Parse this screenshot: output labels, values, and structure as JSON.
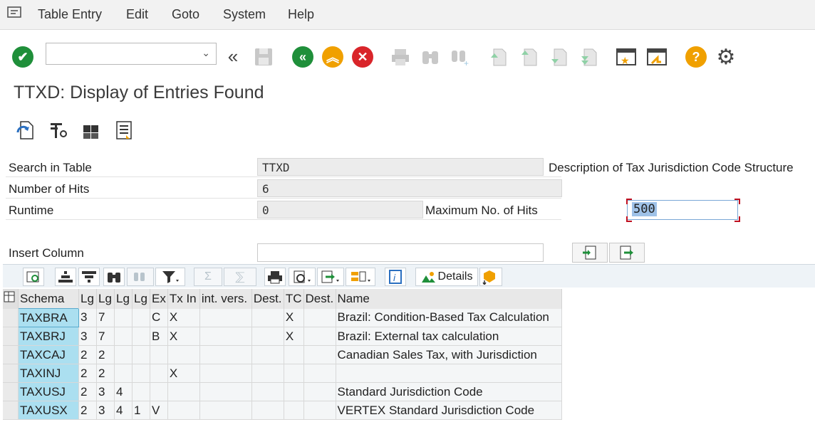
{
  "menu": {
    "items": [
      "Table Entry",
      "Edit",
      "Goto",
      "System",
      "Help"
    ]
  },
  "toolbar": {
    "command_value": ""
  },
  "page": {
    "title": "TTXD: Display of Entries Found"
  },
  "form": {
    "search_label": "Search in Table",
    "search_value": "TTXD",
    "search_desc": "Description of Tax Jurisdiction Code Structure",
    "hits_label": "Number of Hits",
    "hits_value": "6",
    "runtime_label": "Runtime",
    "runtime_value": "0",
    "maxhits_label": "Maximum No. of Hits",
    "maxhits_value": "500",
    "insert_label": "Insert Column",
    "insert_value": ""
  },
  "alv": {
    "details_label": "Details",
    "sum_label": "Σ"
  },
  "table": {
    "headers": [
      "Schema",
      "Lg",
      "Lg",
      "Lg",
      "Lg",
      "Ex",
      "Tx In",
      "int. vers.",
      "Dest.",
      "TC",
      "Dest.",
      "Name"
    ],
    "rows": [
      [
        "TAXBRA",
        "3",
        "7",
        "",
        "",
        "C",
        "X",
        "",
        "",
        "X",
        "",
        "Brazil: Condition-Based Tax Calculation"
      ],
      [
        "TAXBRJ",
        "3",
        "7",
        "",
        "",
        "B",
        "X",
        "",
        "",
        "X",
        "",
        "Brazil: External tax calculation"
      ],
      [
        "TAXCAJ",
        "2",
        "2",
        "",
        "",
        "",
        "",
        "",
        "",
        "",
        "",
        "Canadian Sales Tax, with Jurisdiction"
      ],
      [
        "TAXINJ",
        "2",
        "2",
        "",
        "",
        "",
        "X",
        "",
        "",
        "",
        "",
        ""
      ],
      [
        "TAXUSJ",
        "2",
        "3",
        "4",
        "",
        "",
        "",
        "",
        "",
        "",
        "",
        "Standard Jurisdiction Code"
      ],
      [
        "TAXUSX",
        "2",
        "3",
        "4",
        "1",
        "V",
        "",
        "",
        "",
        "",
        "",
        "VERTEX Standard Jurisdiction Code"
      ]
    ]
  },
  "colors": {
    "accent_green": "#1f8f3a",
    "accent_orange": "#f0a000",
    "accent_red": "#d9252a",
    "key_cell": "#abdff0"
  }
}
